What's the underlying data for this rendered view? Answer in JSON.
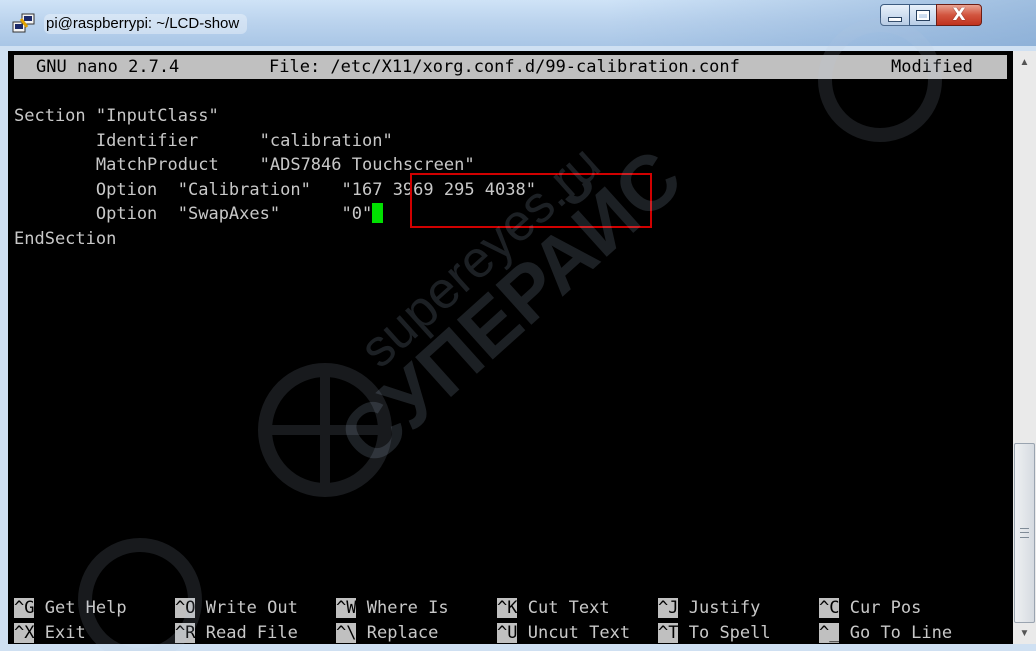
{
  "window": {
    "title": "pi@raspberrypi: ~/LCD-show",
    "controls": {
      "minimize": "minimize",
      "maximize": "maximize",
      "close": "X"
    }
  },
  "nano": {
    "version_label": "GNU nano 2.7.4",
    "file_label": "File: /etc/X11/xorg.conf.d/99-calibration.conf",
    "status": "Modified"
  },
  "file_lines": [
    "Section \"InputClass\"",
    "        Identifier      \"calibration\"",
    "        MatchProduct    \"ADS7846 Touchscreen\"",
    "        Option  \"Calibration\"   ",
    "        Option  \"SwapAxes\"      ",
    "EndSection"
  ],
  "highlight_values": {
    "calibration": "\"167 3969 295 4038\"",
    "swap_axes": "\"0\""
  },
  "shortcuts": {
    "row1": [
      {
        "key": "^G",
        "label": "Get Help"
      },
      {
        "key": "^O",
        "label": "Write Out"
      },
      {
        "key": "^W",
        "label": "Where Is"
      },
      {
        "key": "^K",
        "label": "Cut Text"
      },
      {
        "key": "^J",
        "label": "Justify"
      },
      {
        "key": "^C",
        "label": "Cur Pos"
      }
    ],
    "row2": [
      {
        "key": "^X",
        "label": "Exit"
      },
      {
        "key": "^R",
        "label": "Read File"
      },
      {
        "key": "^\\",
        "label": "Replace"
      },
      {
        "key": "^U",
        "label": "Uncut Text"
      },
      {
        "key": "^T",
        "label": "To Spell"
      },
      {
        "key": "^_",
        "label": "Go To Line"
      }
    ]
  },
  "watermark": {
    "line1": "supereyes.ru",
    "line2": "СУПЕРАЙС"
  },
  "icons": {
    "app": "putty-icon",
    "scroll_up": "scroll-up-arrow-icon",
    "scroll_down": "scroll-down-arrow-icon"
  }
}
